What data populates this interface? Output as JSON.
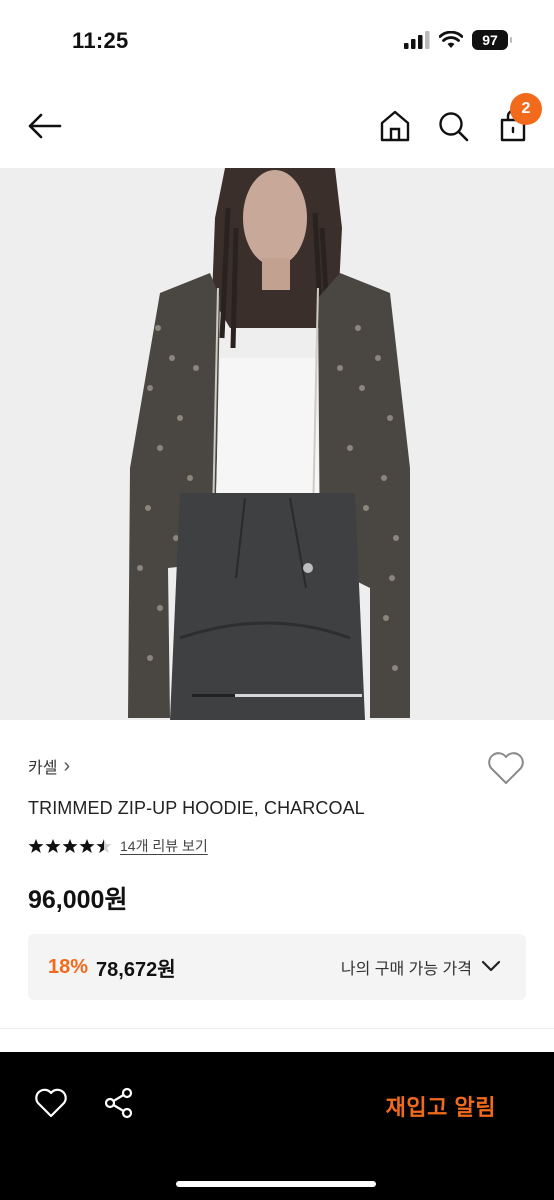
{
  "status_bar": {
    "time": "11:25",
    "battery": "97"
  },
  "nav": {
    "cart_count": "2"
  },
  "carousel": {
    "progress": 0.25
  },
  "product": {
    "brand": "카셀",
    "brand_chevron": "›",
    "name": "TRIMMED ZIP-UP HOODIE, CHARCOAL",
    "rating": 4.5,
    "review_link": "14개 리뷰 보기",
    "price": "96,000원"
  },
  "benefit": {
    "discount_rate": "18%",
    "discount_price": "78,672원",
    "label": "나의 구매 가능 가격"
  },
  "bottom_bar": {
    "restock_label": "재입고 알림"
  },
  "colors": {
    "accent": "#f26a1b",
    "bottom_bar": "#000000"
  },
  "icons": [
    "back-arrow-icon",
    "home-icon",
    "search-icon",
    "cart-icon",
    "heart-icon",
    "star-icon",
    "chevron-down-icon",
    "share-icon"
  ]
}
